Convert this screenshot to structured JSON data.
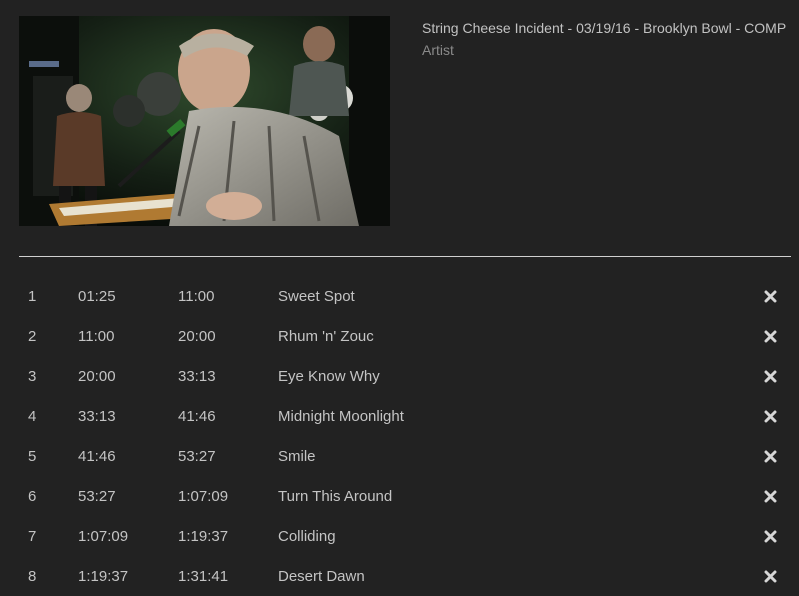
{
  "video": {
    "title": "String Cheese Incident - 03/19/16 - Brooklyn Bowl - COMP",
    "artist": "Artist",
    "thumbnail_icon": "concert-video-thumbnail"
  },
  "tracks": [
    {
      "num": "1",
      "start": "01:25",
      "end": "11:00",
      "title": "Sweet Spot"
    },
    {
      "num": "2",
      "start": "11:00",
      "end": "20:00",
      "title": "Rhum 'n' Zouc"
    },
    {
      "num": "3",
      "start": "20:00",
      "end": "33:13",
      "title": "Eye Know Why"
    },
    {
      "num": "4",
      "start": "33:13",
      "end": "41:46",
      "title": "Midnight Moonlight"
    },
    {
      "num": "5",
      "start": "41:46",
      "end": "53:27",
      "title": "Smile"
    },
    {
      "num": "6",
      "start": "53:27",
      "end": "1:07:09",
      "title": "Turn This Around"
    },
    {
      "num": "7",
      "start": "1:07:09",
      "end": "1:19:37",
      "title": "Colliding"
    },
    {
      "num": "8",
      "start": "1:19:37",
      "end": "1:31:41",
      "title": "Desert Dawn"
    }
  ],
  "remove_icon": "close-x-icon",
  "colors": {
    "background": "#222222",
    "text": "#c4c4c4",
    "muted": "#8a8a8a",
    "divider": "#d0d0d0"
  }
}
